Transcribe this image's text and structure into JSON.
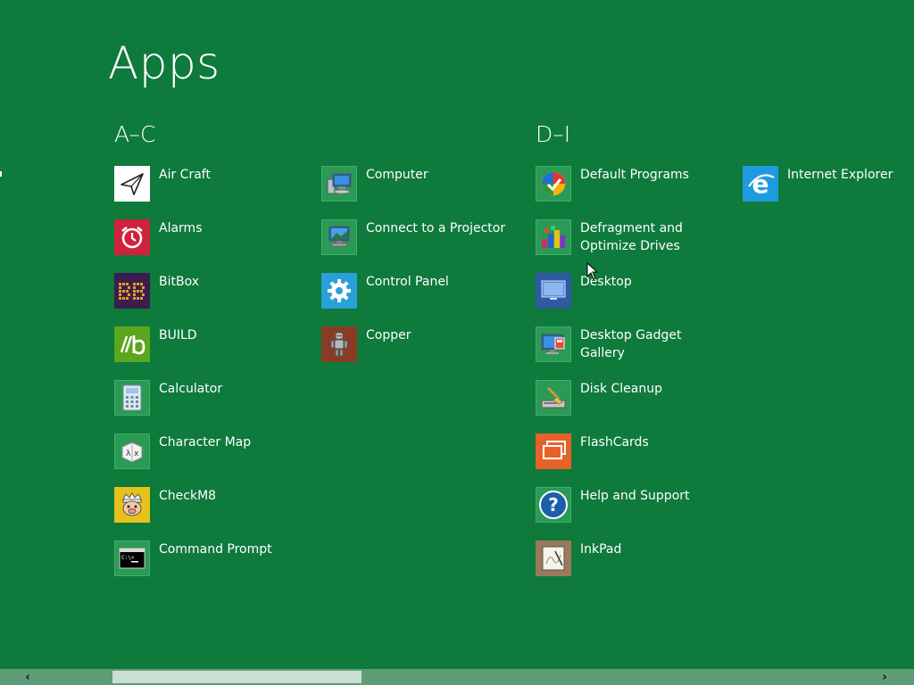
{
  "title": "Apps",
  "groups": {
    "a_c": "A–C",
    "d_i": "D–I"
  },
  "apps": {
    "air_craft": "Air Craft",
    "alarms": "Alarms",
    "bitbox": "BitBox",
    "build": "BUILD",
    "calculator": "Calculator",
    "character_map": "Character Map",
    "checkm8": "CheckM8",
    "command_prompt": "Command Prompt",
    "computer": "Computer",
    "connect_projector": "Connect to a Projector",
    "control_panel": "Control Panel",
    "copper": "Copper",
    "default_programs": "Default Programs",
    "defragment": "Defragment and Optimize Drives",
    "desktop": "Desktop",
    "desktop_gadget_gallery": "Desktop Gadget Gallery",
    "disk_cleanup": "Disk Cleanup",
    "flashcards": "FlashCards",
    "help_support": "Help and Support",
    "inkpad": "InkPad",
    "internet_explorer": "Internet Explorer"
  },
  "icons": {
    "air_craft": "paper-plane-icon",
    "alarms": "alarm-clock-icon",
    "bitbox": "bitbox-icon",
    "build": "build-icon",
    "calculator": "calculator-icon",
    "character_map": "character-map-icon",
    "checkm8": "checkm8-icon",
    "command_prompt": "command-prompt-icon",
    "computer": "computer-icon",
    "connect_projector": "projector-icon",
    "control_panel": "gear-icon",
    "copper": "copper-robot-icon",
    "default_programs": "default-programs-icon",
    "defragment": "defragment-icon",
    "desktop": "desktop-icon",
    "desktop_gadget_gallery": "gadget-gallery-icon",
    "disk_cleanup": "disk-cleanup-icon",
    "flashcards": "flashcards-icon",
    "help_support": "help-icon",
    "inkpad": "inkpad-icon",
    "internet_explorer": "internet-explorer-icon"
  },
  "scrollbar": {
    "left_arrow": "‹",
    "right_arrow": "›"
  },
  "colors": {
    "background": "#0e7a3c",
    "tile_alarms": "#d0223c",
    "tile_bitbox": "#3b1d4e",
    "tile_build": "#5aa61c",
    "tile_control_panel": "#2aa0d8",
    "tile_copper": "#8a3b26",
    "tile_flashcards": "#e8612a",
    "tile_internet_explorer": "#1e9be0",
    "tile_default": "#2a9a55"
  }
}
